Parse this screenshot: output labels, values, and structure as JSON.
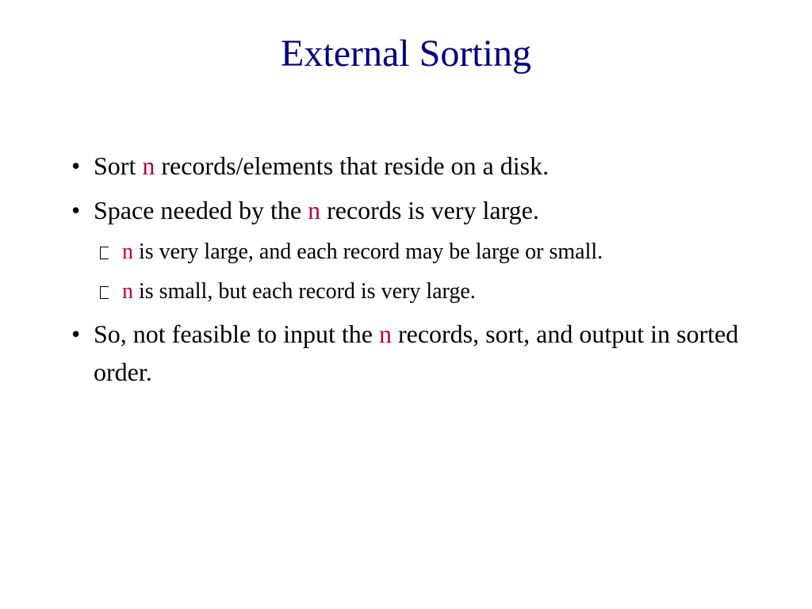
{
  "title": "External Sorting",
  "bullets": {
    "b1_pre": "Sort ",
    "b1_hl": "n",
    "b1_post": " records/elements that reside on a disk.",
    "b2_pre": "Space needed by the ",
    "b2_hl": "n",
    "b2_post": " records is very large.",
    "b2a_hl": "n",
    "b2a_post": " is very large, and each record may be large or small.",
    "b2b_hl": "n",
    "b2b_post": " is small, but each record is very large.",
    "b3_pre": "So, not feasible to input the ",
    "b3_hl": "n",
    "b3_post": " records, sort, and output in sorted order."
  }
}
